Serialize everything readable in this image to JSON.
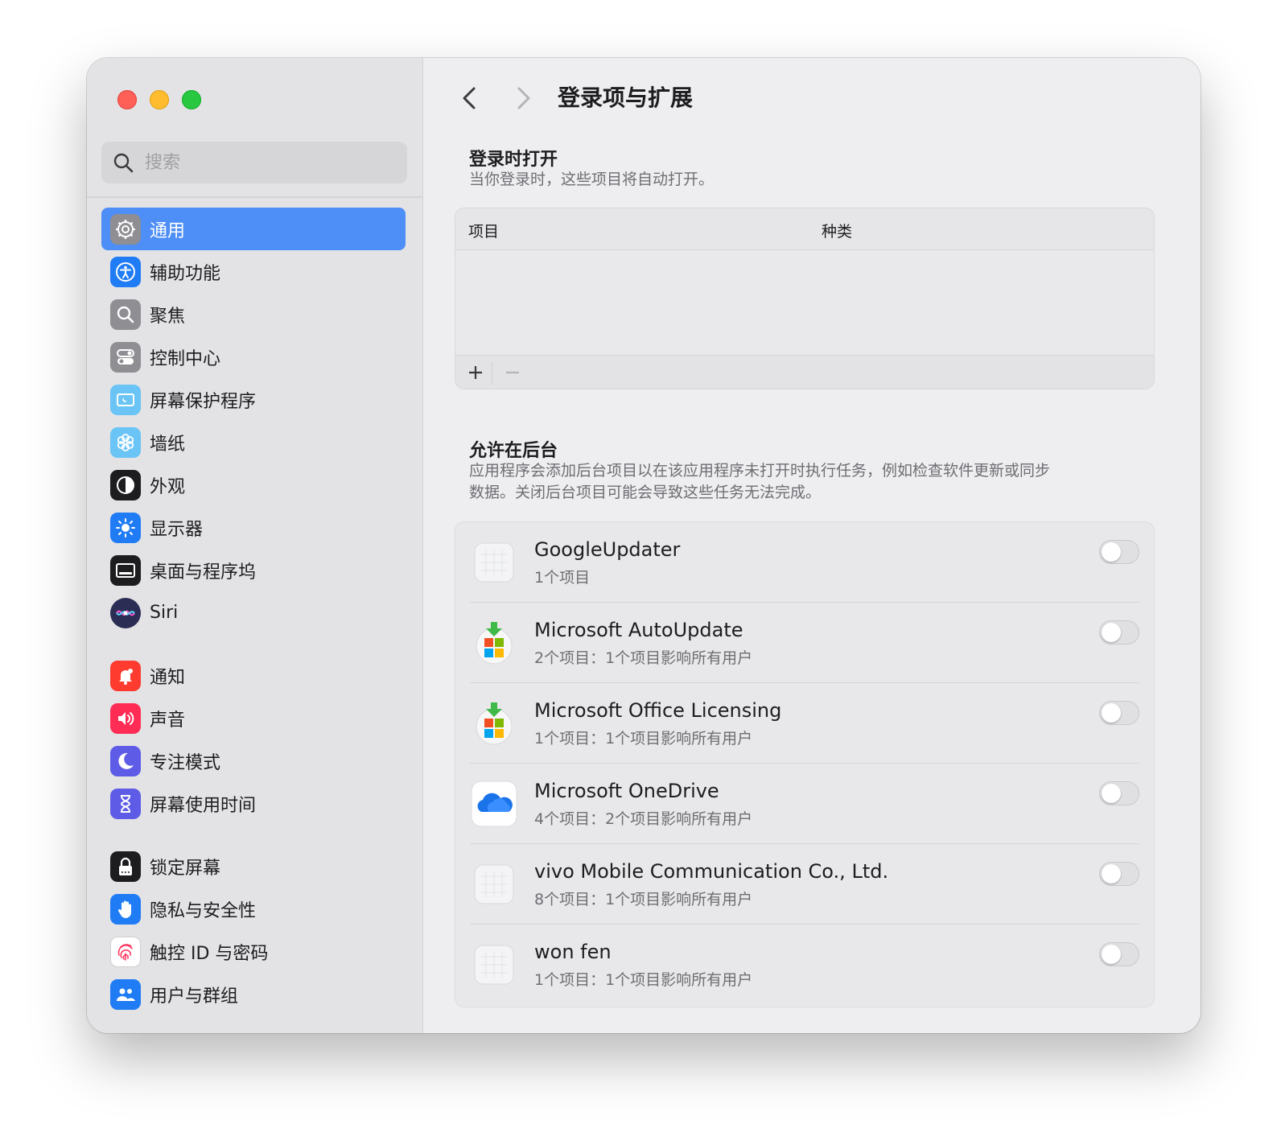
{
  "window": {
    "title": "登录项与扩展"
  },
  "search": {
    "placeholder": "搜索"
  },
  "sidebar": {
    "items": [
      {
        "label": "通用",
        "icon": "gear-icon",
        "color": "#8e8e93"
      },
      {
        "label": "辅助功能",
        "icon": "accessibility-icon",
        "color": "#1f7cf5"
      },
      {
        "label": "聚焦",
        "icon": "magnifier-icon",
        "color": "#8e8e93"
      },
      {
        "label": "控制中心",
        "icon": "switches-icon",
        "color": "#8e8e93"
      },
      {
        "label": "屏幕保护程序",
        "icon": "screensaver-icon",
        "color": "#5ac8fa"
      },
      {
        "label": "墙纸",
        "icon": "flower-icon",
        "color": "#5ac8fa"
      },
      {
        "label": "外观",
        "icon": "appearance-icon",
        "color": "#1d1d1f"
      },
      {
        "label": "显示器",
        "icon": "sun-icon",
        "color": "#1f7cf5"
      },
      {
        "label": "桌面与程序坞",
        "icon": "dock-icon",
        "color": "#1d1d1f"
      },
      {
        "label": "Siri",
        "icon": "siri-icon",
        "color": "#2b2d55"
      },
      {
        "label": "通知",
        "icon": "bell-icon",
        "color": "#ff3b30"
      },
      {
        "label": "声音",
        "icon": "speaker-icon",
        "color": "#ff2d55"
      },
      {
        "label": "专注模式",
        "icon": "moon-icon",
        "color": "#5e5ce6"
      },
      {
        "label": "屏幕使用时间",
        "icon": "hourglass-icon",
        "color": "#5e5ce6"
      },
      {
        "label": "锁定屏幕",
        "icon": "lock-icon",
        "color": "#1d1d1f"
      },
      {
        "label": "隐私与安全性",
        "icon": "hand-icon",
        "color": "#1f7cf5"
      },
      {
        "label": "触控 ID 与密码",
        "icon": "fingerprint-icon",
        "color": "#ffffff"
      },
      {
        "label": "用户与群组",
        "icon": "users-icon",
        "color": "#1f7cf5"
      }
    ]
  },
  "login": {
    "title": "登录时打开",
    "desc": "当你登录时，这些项目将自动打开。",
    "col_item": "项目",
    "col_kind": "种类"
  },
  "background": {
    "title": "允许在后台",
    "desc1": "应用程序会添加后台项目以在该应用程序未打开时执行任务，例如检查软件更新或同步",
    "desc2": "数据。关闭后台项目可能会导致这些任务无法完成。",
    "items": [
      {
        "name": "GoogleUpdater",
        "sub": "1个项目",
        "icon": "generic-app-icon",
        "enabled": false
      },
      {
        "name": "Microsoft AutoUpdate",
        "sub": "2个项目：1个项目影响所有用户",
        "icon": "microsoft-update-icon",
        "enabled": false
      },
      {
        "name": "Microsoft Office Licensing",
        "sub": "1个项目：1个项目影响所有用户",
        "icon": "microsoft-update-icon",
        "enabled": false
      },
      {
        "name": "Microsoft OneDrive",
        "sub": "4个项目：2个项目影响所有用户",
        "icon": "onedrive-icon",
        "enabled": false
      },
      {
        "name": "vivo Mobile Communication Co., Ltd.",
        "sub": "8个项目：1个项目影响所有用户",
        "icon": "generic-app-icon",
        "enabled": false
      },
      {
        "name": "won fen",
        "sub": "1个项目：1个项目影响所有用户",
        "icon": "generic-app-icon",
        "enabled": false
      }
    ]
  }
}
